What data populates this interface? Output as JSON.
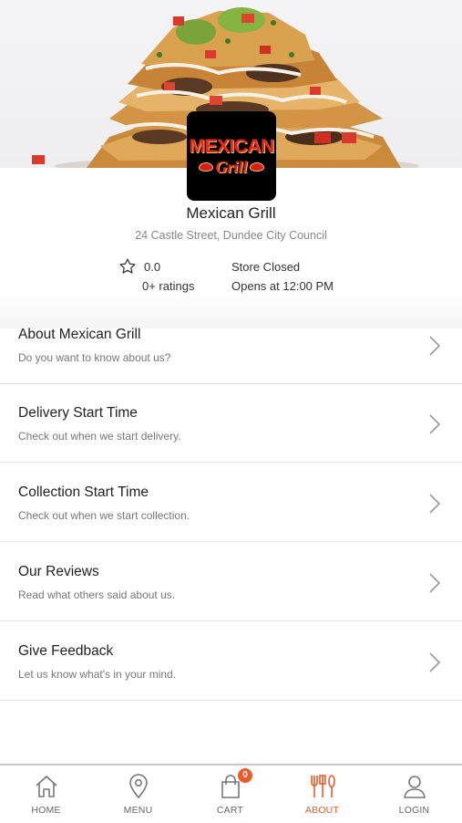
{
  "restaurant": {
    "name": "Mexican Grill",
    "address": "24 Castle Street, Dundee City Council",
    "logo_text_top": "MEXICAN",
    "logo_text_bottom": "Grill",
    "rating_value": "0.0",
    "rating_count": "0+ ratings",
    "store_status": "Store Closed",
    "store_opens": "Opens at 12:00 PM"
  },
  "menu": {
    "items": [
      {
        "title": "About Mexican Grill",
        "subtitle": "Do you want to know about us?"
      },
      {
        "title": "Delivery Start Time",
        "subtitle": "Check out when we start delivery."
      },
      {
        "title": "Collection Start Time",
        "subtitle": "Check out when we start collection."
      },
      {
        "title": "Our Reviews",
        "subtitle": "Read what others said about us."
      },
      {
        "title": "Give Feedback",
        "subtitle": "Let us know what's in your mind."
      }
    ]
  },
  "nav": {
    "items": [
      {
        "label": "HOME",
        "icon": "home-icon"
      },
      {
        "label": "MENU",
        "icon": "location-pin-icon"
      },
      {
        "label": "CART",
        "icon": "shopping-bag-icon",
        "badge": "0"
      },
      {
        "label": "ABOUT",
        "icon": "fork-knife-icon",
        "active": true
      },
      {
        "label": "LOGIN",
        "icon": "user-icon"
      }
    ]
  },
  "colors": {
    "accent": "#ec5a2a",
    "logo_background": "#000000",
    "logo_text": "#e8231f"
  }
}
